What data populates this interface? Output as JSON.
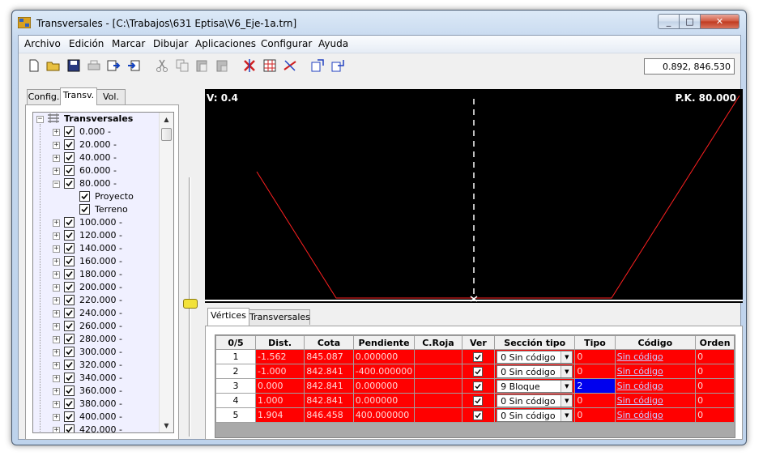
{
  "window": {
    "title": "Transversales - [C:\\Trabajos\\631 Eptisa\\V6_Eje-1a.trn]"
  },
  "menu": [
    "Archivo",
    "Edición",
    "Marcar",
    "Dibujar",
    "Aplicaciones",
    "Configurar",
    "Ayuda"
  ],
  "toolbar": {
    "icons": [
      "new-file-icon",
      "open-folder-icon",
      "save-icon",
      "print-icon",
      "export-icon",
      "import-icon",
      "cut-icon",
      "copy-icon",
      "paste-icon",
      "paste-special-icon",
      "delete-mark-icon",
      "grid-edit-icon",
      "measure-icon",
      "section-left-icon",
      "section-right-icon"
    ],
    "coordinates": "0.892, 846.530"
  },
  "left_tabs": [
    "Config.",
    "Transv.",
    "Vol."
  ],
  "tree": {
    "root": "Transversales",
    "items": [
      "0.000 -",
      "20.000 -",
      "40.000 -",
      "60.000 -",
      "80.000 -",
      "100.000 -",
      "120.000 -",
      "140.000 -",
      "160.000 -",
      "180.000 -",
      "200.000 -",
      "220.000 -",
      "240.000 -",
      "260.000 -",
      "280.000 -",
      "300.000 -",
      "320.000 -",
      "340.000 -",
      "360.000 -",
      "380.000 -",
      "400.000 -",
      "420.000 -"
    ],
    "expanded_children": [
      "Proyecto",
      "Terreno"
    ]
  },
  "canvas": {
    "v_label": "V: 0.4",
    "pk_label": "P.K. 80.000"
  },
  "bottom_tabs": [
    "Vértices",
    "Transversales"
  ],
  "grid": {
    "headers": [
      "0/5",
      "Dist.",
      "Cota",
      "Pendiente",
      "C.Roja",
      "Ver",
      "Sección tipo",
      "Tipo",
      "Código",
      "Orden"
    ],
    "rows": [
      {
        "n": "1",
        "dist": "-1.562",
        "cota": "845.087",
        "pend": "0.000000",
        "croja": "",
        "ver": true,
        "seccion": "0  Sin código",
        "tipo": "0",
        "codigo": "Sin código",
        "orden": "0"
      },
      {
        "n": "2",
        "dist": "-1.000",
        "cota": "842.841",
        "pend": "-400.000000",
        "croja": "",
        "ver": true,
        "seccion": "0  Sin código",
        "tipo": "0",
        "codigo": "Sin código",
        "orden": "0"
      },
      {
        "n": "3",
        "dist": "0.000",
        "cota": "842.841",
        "pend": "0.000000",
        "croja": "",
        "ver": true,
        "seccion": "9  Bloque",
        "tipo": "2",
        "codigo": "Sin código",
        "orden": "0"
      },
      {
        "n": "4",
        "dist": "1.000",
        "cota": "842.841",
        "pend": "0.000000",
        "croja": "",
        "ver": true,
        "seccion": "0  Sin código",
        "tipo": "0",
        "codigo": "Sin código",
        "orden": "0"
      },
      {
        "n": "5",
        "dist": "1.904",
        "cota": "846.458",
        "pend": "400.000000",
        "croja": "",
        "ver": true,
        "seccion": "0  Sin código",
        "tipo": "0",
        "codigo": "Sin código",
        "orden": "0"
      }
    ]
  }
}
